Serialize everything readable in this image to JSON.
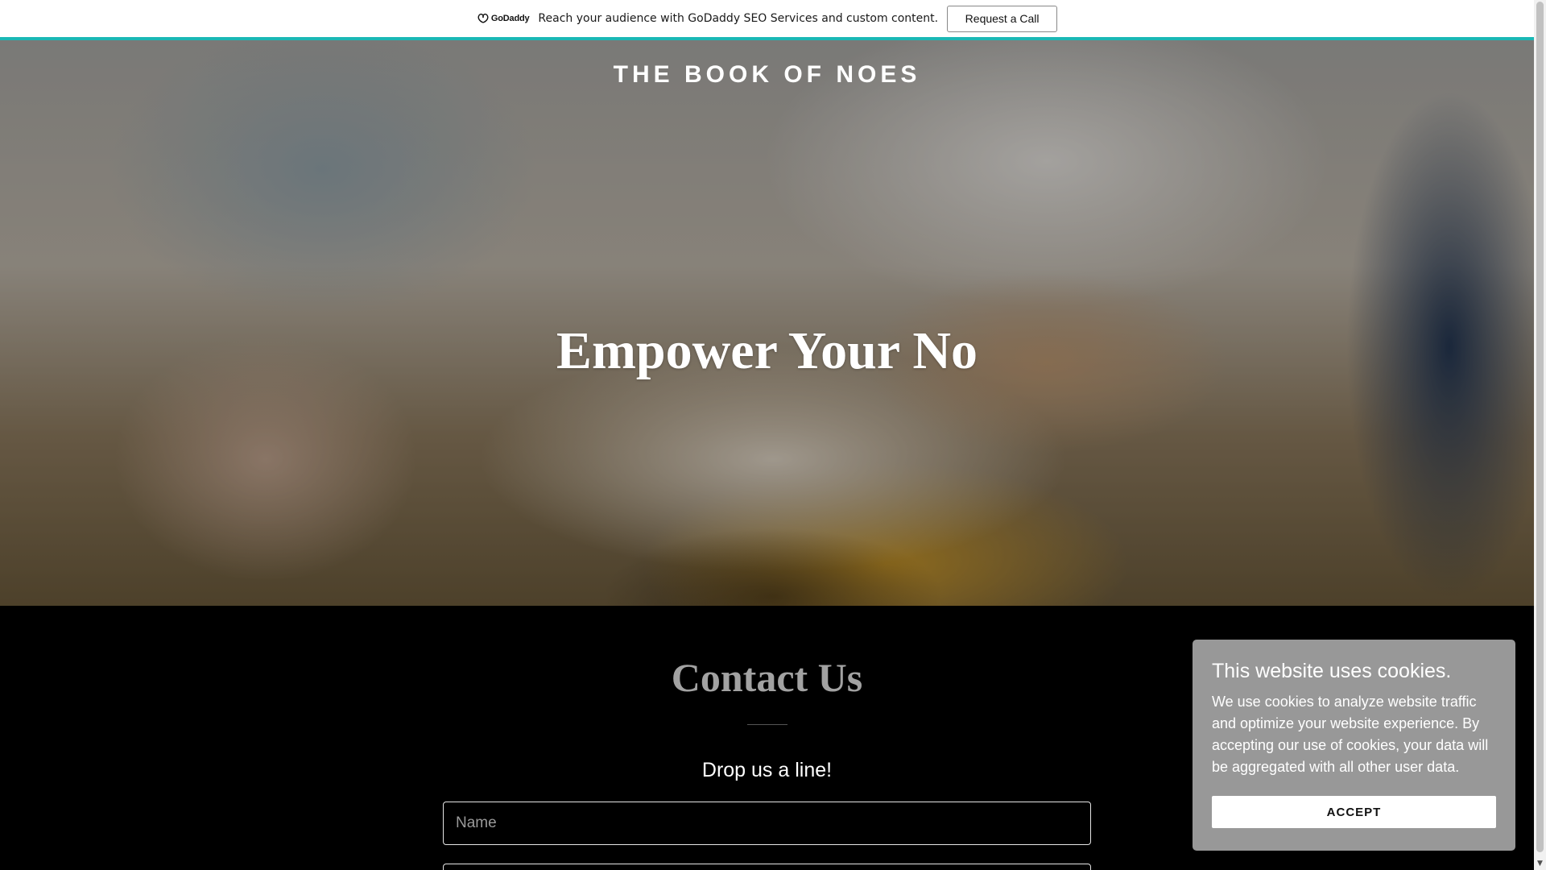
{
  "promo_bar": {
    "logo_text": "GoDaddy",
    "message": "Reach your audience with GoDaddy SEO Services and custom content.",
    "button_label": "Request a Call",
    "accent_color": "#1bb8b5"
  },
  "hero": {
    "site_title": "THE BOOK OF NOES",
    "heading": "Empower Your No"
  },
  "contact": {
    "title": "Contact Us",
    "subtitle": "Drop us a line!",
    "name_placeholder": "Name",
    "email_placeholder": ""
  },
  "cookie_banner": {
    "title": "This website uses cookies.",
    "body": "We use cookies to analyze website traffic and optimize your website experience. By accepting our use of cookies, your data will be aggregated with all other user data.",
    "accept_label": "ACCEPT"
  },
  "scrollbar": {
    "down_arrow": "▼"
  }
}
